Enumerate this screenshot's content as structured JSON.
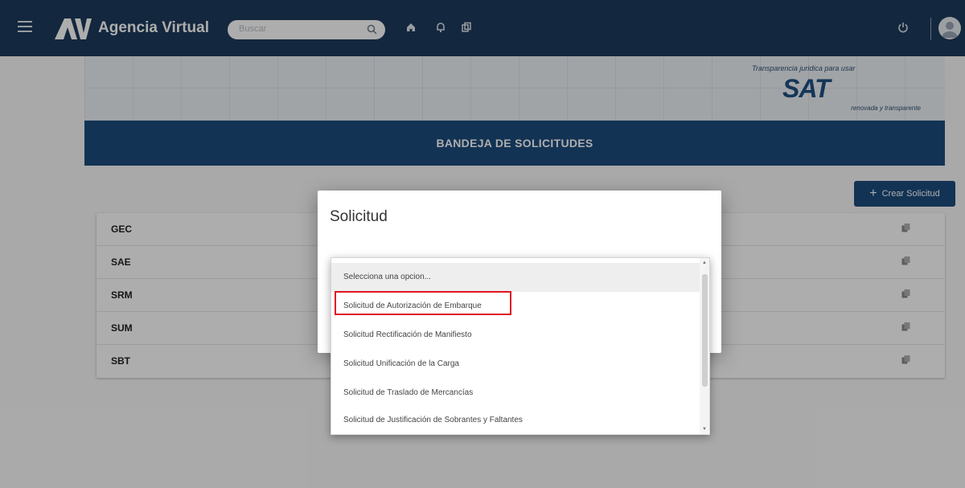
{
  "app": {
    "title": "Agencia Virtual"
  },
  "header": {
    "search_placeholder": "Buscar",
    "icons": [
      "menu-icon",
      "home-icon",
      "bell-icon",
      "copy-icon",
      "power-icon",
      "user-avatar"
    ]
  },
  "banner": {
    "tagline_top": "Transparencia juridica para usar",
    "logo_text": "SAT",
    "tagline_bottom": "renovada y transparente"
  },
  "page": {
    "section_title": "BANDEJA DE SOLICITUDES",
    "create_button": "Crear Solicitud"
  },
  "list": {
    "rows": [
      "GEC",
      "SAE",
      "SRM",
      "SUM",
      "SBT"
    ]
  },
  "modal": {
    "title": "Solicitud",
    "dropdown_options": [
      "Selecciona una opcion...",
      "Solicitud de Autorización de Embarque",
      "Solicitud Rectificación de Manifiesto",
      "Solicitud Unificación de la Carga",
      "Solicitud de Traslado de Mercancías",
      "Solicitud de Justificación de Sobrantes y Faltantes"
    ]
  },
  "colors": {
    "navbar": "#1d3a5c",
    "primary": "#1d4c7d",
    "highlight": "#e0161f"
  }
}
